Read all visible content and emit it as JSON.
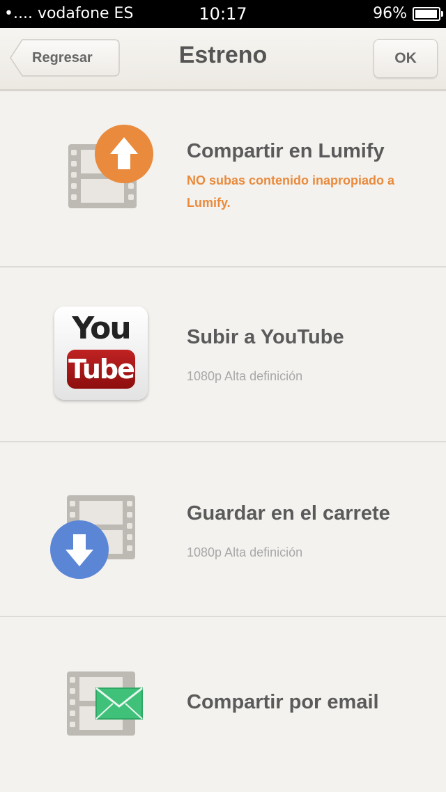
{
  "status_bar": {
    "carrier": "•.... vodafone ES",
    "time": "10:17",
    "battery": "96%",
    "battery_level": 0.96
  },
  "navbar": {
    "back_label": "Regresar",
    "title": "Estreno",
    "ok_label": "OK"
  },
  "options": [
    {
      "title": "Compartir en Lumify",
      "warning": "NO subas contenido inapropiado a Lumify.",
      "icon": "film-upload-icon"
    },
    {
      "title": "Subir a YouTube",
      "subtitle": "1080p Alta definición",
      "icon": "youtube-icon",
      "logo_you": "You",
      "logo_tube": "Tube"
    },
    {
      "title": "Guardar en el carrete",
      "subtitle": "1080p Alta definición",
      "icon": "film-download-icon"
    },
    {
      "title": "Compartir por email",
      "icon": "film-email-icon"
    }
  ],
  "colors": {
    "accent_orange": "#e98a3c",
    "download_blue": "#5b86d6",
    "email_green": "#3fc17a"
  }
}
